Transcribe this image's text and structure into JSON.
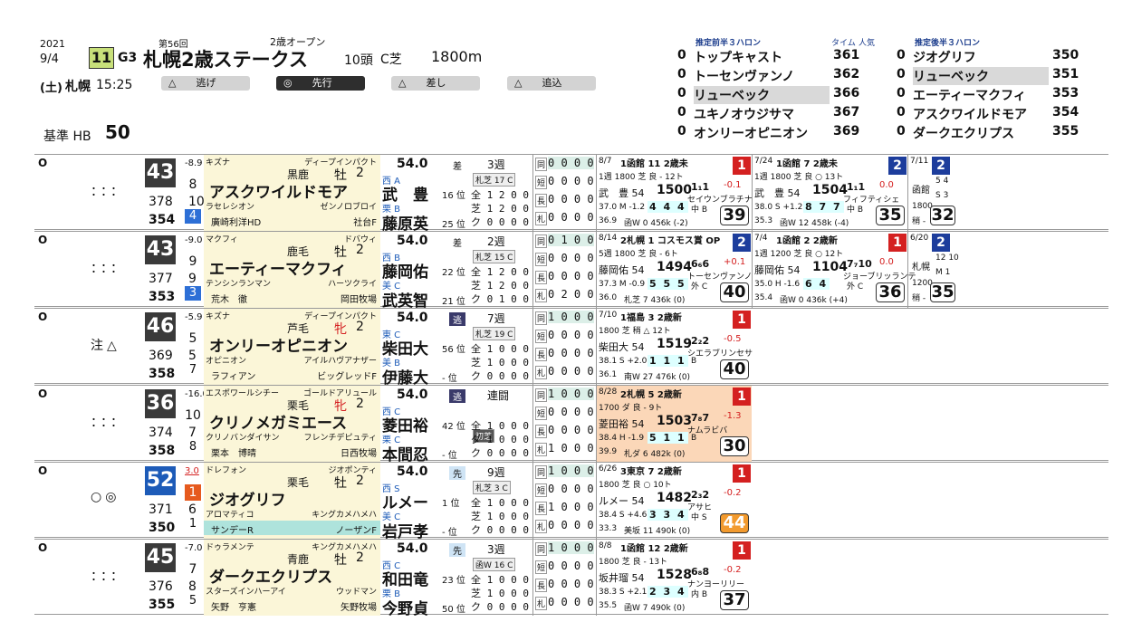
{
  "header": {
    "year": "2021",
    "date": "9/4",
    "day": "(土)",
    "venue": "札幌",
    "post_time": "15:25",
    "race_no": "11",
    "grade": "G3",
    "race_name": "札幌2歳ステークス",
    "edition": "第56回",
    "race_class": "2歳オープン",
    "field_size": "10頭",
    "course": "C芝",
    "distance": "1800m",
    "base_label": "基準 HB",
    "base_value": "50",
    "pace_styles": [
      {
        "mark": "△",
        "label": "逃げ"
      },
      {
        "mark": "◎",
        "label": "先行"
      },
      {
        "mark": "△",
        "label": "差し"
      },
      {
        "mark": "△",
        "label": "追込"
      }
    ]
  },
  "pace_top": {
    "title": "推定前半３ハロン",
    "col_time": "タイム",
    "col_pop": "人気",
    "rows": [
      {
        "pre": "0",
        "name": "トップキャスト",
        "time": "361"
      },
      {
        "pre": "0",
        "name": "トーセンヴァンノ",
        "time": "362"
      },
      {
        "pre": "0",
        "name": "リューベック",
        "time": "366"
      },
      {
        "pre": "0",
        "name": "ユキノオウジサマ",
        "time": "367"
      },
      {
        "pre": "0",
        "name": "オンリーオピニオン",
        "time": "369"
      }
    ]
  },
  "pace_late": {
    "title": "推定後半３ハロン",
    "rows": [
      {
        "pre": "0",
        "name": "ジオグリフ",
        "time": "350"
      },
      {
        "pre": "0",
        "name": "リューベック",
        "time": "351"
      },
      {
        "pre": "0",
        "name": "エーティーマクフィ",
        "time": "353"
      },
      {
        "pre": "0",
        "name": "アスクワイルドモア",
        "time": "354"
      },
      {
        "pre": "0",
        "name": "ダークエクリプス",
        "time": "355"
      }
    ]
  },
  "horses": [
    {
      "mark": "O",
      "marks": "：：：",
      "idx": "43",
      "idx_diff": "-8.9",
      "idx_sub": "8",
      "v1": "378",
      "v1b": "10",
      "v2": "354",
      "gate": "4",
      "gate_color": "#2d6fd6",
      "sire": "キズナ",
      "dam_sire": "ディープインパクト",
      "coat": "黒鹿",
      "sex": "牡",
      "age": "2",
      "name": "アスクワイルドモア",
      "dam": "ラセレシオン",
      "bms": "ゼンノロブロイ",
      "owner": "廣崎利洋HD",
      "breeder": "社台F",
      "owner_bg": "#fbf6d8",
      "weight": "54.0",
      "style": "差",
      "jockey_region": "西",
      "jockey_grade": "A",
      "jockey": "武　豊",
      "jockey_pos": "16 位",
      "trainer_region": "栗",
      "trainer_grade": "B",
      "trainer": "藤原英",
      "trainer_pos": "25 位",
      "weeks": "3週",
      "course_tag": "札芝 17 C",
      "stats_label": [
        "同",
        "短",
        "長",
        "札"
      ],
      "stats": [
        "0 0 0 0",
        "0 0 0 0",
        "0 0 0 0",
        "0 0 0 0"
      ],
      "jstats": [
        "全 1 2 0 0",
        "芝 1 2 0 0",
        "ク 0 0 0 0"
      ],
      "past": [
        {
          "date": "8/7",
          "race": "1函館 11 2歳未",
          "rank": "1",
          "rank_color": "red",
          "dist": "1週 1800 芝 良 - 12ト",
          "pop": "1",
          "diff": "-0.1",
          "jockey": "武　豊 54",
          "time": "1500",
          "pos": "1₁1",
          "rival": "セイウンブラチナ",
          "l3": "37.0 M -1.2",
          "corners": "4 4 4",
          "side": "中 B",
          "hw": "36.9",
          "weight": "函W 0 456k (-2)",
          "score": "39"
        },
        {
          "date": "7/24",
          "race": "1函館 7 2歳未",
          "rank": "2",
          "rank_color": "blue",
          "dist": "1週 1800 芝 良 ○ 13ト",
          "pop": "4",
          "diff": "0.0",
          "jockey": "武　豊 54",
          "time": "1504",
          "pos": "1₁1",
          "rival": "フィフティシェ",
          "l3": "38.0 S +1.2",
          "corners": "8 7 7",
          "side": "中 B",
          "hw": "35.3",
          "weight": "函W 12 458k (-4)",
          "score": "35"
        },
        {
          "date": "7/11",
          "race": "函館",
          "rank": "2",
          "rank_color": "blue",
          "dist": "1800",
          "pop": "",
          "diff": "",
          "jockey": "5 4",
          "time": "S 3",
          "pos": "",
          "rival": "",
          "l3": "",
          "corners": "",
          "side": "",
          "hw": "",
          "weight": "稍 -",
          "score": "32"
        }
      ]
    },
    {
      "mark": "O",
      "marks": "：：：",
      "idx": "43",
      "idx_diff": "-9.0",
      "idx_sub": "9",
      "v1": "377",
      "v1b": "9",
      "v2": "353",
      "gate": "3",
      "gate_color": "#2d6fd6",
      "sire": "マクフィ",
      "dam_sire": "ドバウィ",
      "coat": "鹿毛",
      "sex": "牡",
      "age": "2",
      "name": "エーティーマクフィ",
      "dam": "テンシンランマン",
      "bms": "ハーツクライ",
      "owner": "荒木　徹",
      "breeder": "岡田牧場",
      "owner_bg": "#fbf6d8",
      "weight": "54.0",
      "style": "差",
      "jockey_region": "西",
      "jockey_grade": "B",
      "jockey": "藤岡佑",
      "jockey_pos": "22 位",
      "trainer_region": "美",
      "trainer_grade": "C",
      "trainer": "武英智",
      "trainer_pos": "21 位",
      "weeks": "2週",
      "course_tag": "札芝 15 C",
      "stats_label": [
        "同",
        "短",
        "長",
        "札"
      ],
      "stats": [
        "0 1 0 0",
        "0 0 0 0",
        "0 0 0 0",
        "0 2 0 0"
      ],
      "jstats": [
        "全 1 2 0 0",
        "芝 1 2 0 0",
        "ク 0 1 0 0"
      ],
      "past": [
        {
          "date": "8/14",
          "race": "2札幌 1 コスモス賞 OP",
          "rank": "2",
          "rank_color": "blue",
          "dist": "5週 1800 芝 良 - 6ト",
          "pop": "3",
          "diff": "+0.1",
          "jockey": "藤岡佑 54",
          "time": "1494",
          "pos": "6₆6",
          "rival": "トーセンヴァンノ",
          "l3": "37.3 M -0.9",
          "corners": "5 5 5",
          "side": "外 C",
          "hw": "36.0",
          "weight": "札芝 7 436k (0)",
          "score": "40"
        },
        {
          "date": "7/4",
          "race": "1函館 2 2歳新",
          "rank": "1",
          "rank_color": "red",
          "dist": "1週 1200 芝 良 ○ 12ト",
          "pop": "1",
          "diff": "0.0",
          "jockey": "藤岡佑 54",
          "time": "1104",
          "pos": "7₇10",
          "rival": "ジョーブリッランテ",
          "l3": "35.0 H -1.6",
          "corners": "6 4",
          "side": "外 C",
          "hw": "35.4",
          "weight": "函W 0 436k (+4)",
          "score": "36"
        },
        {
          "date": "6/20",
          "race": "札幌",
          "rank": "2",
          "rank_color": "blue",
          "dist": "1200",
          "pop": "",
          "diff": "",
          "jockey": "12 10",
          "time": "M 1",
          "pos": "",
          "rival": "",
          "l3": "",
          "corners": "",
          "side": "",
          "hw": "",
          "weight": "稍 -",
          "score": "35"
        }
      ]
    },
    {
      "mark": "O",
      "marks": "注△",
      "idx": "46",
      "idx_diff": "-5.9",
      "idx_sub": "5",
      "v1": "369",
      "v1b": "5",
      "v2": "358",
      "gate": "7",
      "gate_color": "#ffffff",
      "sire": "キズナ",
      "dam_sire": "ディープインパクト",
      "coat": "芦毛",
      "sex": "牝",
      "age": "2",
      "name": "オンリーオピニオン",
      "dam": "オピニオン",
      "bms": "アイルハヴアナザー",
      "owner": "ラフィアン",
      "breeder": "ビッグレッドF",
      "owner_bg": "#fbf6d8",
      "weight": "54.0",
      "style": "逃",
      "jockey_region": "東",
      "jockey_grade": "C",
      "jockey": "柴田大",
      "jockey_pos": "56 位",
      "trainer_region": "美",
      "trainer_grade": "B",
      "trainer": "伊藤大",
      "trainer_pos": "- 位",
      "weeks": "7週",
      "course_tag": "札芝 19 C",
      "stats_label": [
        "同",
        "短",
        "長",
        "札"
      ],
      "stats": [
        "1 0 0 0",
        "0 0 0 0",
        "0 0 0 0",
        "0 0 0 0"
      ],
      "jstats": [
        "全 1 0 0 0",
        "芝 1 0 0 0",
        "ク 0 0 0 0"
      ],
      "past": [
        {
          "date": "7/10",
          "race": "1福島 3 2歳新",
          "rank": "1",
          "rank_color": "red",
          "dist": "1800 芝 稍 △ 12ト",
          "pop": "1",
          "diff": "-0.5",
          "jockey": "柴田大 54",
          "time": "1519",
          "pos": "2₂2",
          "rival": "シエラブリンセサ",
          "l3": "38.1 S +2.0",
          "corners": "1 1 1",
          "side": "B",
          "hw": "36.1",
          "weight": "南W 27 476k (0)",
          "score": "40"
        }
      ]
    },
    {
      "mark": "O",
      "marks": "：：：",
      "idx": "36",
      "idx_diff": "-16.0",
      "idx_sub": "10",
      "v1": "374",
      "v1b": "7",
      "v2": "358",
      "gate": "8",
      "gate_color": "#ffffff",
      "sire": "エスポワールシチー",
      "dam_sire": "ゴールドアリュール",
      "coat": "栗毛",
      "sex": "牝",
      "age": "2",
      "name": "クリノメガミエース",
      "dam": "クリノバンダイサン",
      "bms": "フレンチデピュティ",
      "owner": "栗本　博晴",
      "breeder": "日西牧場",
      "owner_bg": "#fbf6d8",
      "weight": "54.0",
      "style": "逃",
      "jockey_region": "西",
      "jockey_grade": "C",
      "jockey": "菱田裕",
      "jockey_pos": "42 位",
      "trainer_region": "栗",
      "trainer_grade": "C",
      "trainer": "本間忍",
      "trainer_pos": "- 位",
      "weeks": "連闘",
      "course_tag": "初芝",
      "stats_label": [
        "同",
        "短",
        "長",
        "札"
      ],
      "stats": [
        "1 0 0 0",
        "0 0 0 0",
        "0 0 0 0",
        "1 0 0 0"
      ],
      "jstats": [
        "全 1 0 0 0",
        "ダ 1 0 0 0",
        "ク 0 0 0 0"
      ],
      "past": [
        {
          "date": "8/28",
          "race": "2札幌 5 2歳新",
          "rank": "1",
          "rank_color": "red",
          "dist": "1700 ダ 良 - 9ト",
          "pop": "7",
          "diff": "-1.3",
          "jockey": "菱田裕 54",
          "time": "1503",
          "pos": "7₈7",
          "rival": "ナムラビバ",
          "l3": "38.4 H -1.9",
          "corners": "5 1 1",
          "side": "B",
          "hw": "39.9",
          "weight": "札ダ 6 482k (0)",
          "score": "30"
        }
      ]
    },
    {
      "mark": "O",
      "marks": "○◎",
      "idx": "52",
      "idx_diff": "3.0",
      "idx_sub": "1",
      "v1": "371",
      "v1b": "6",
      "v2": "350",
      "gate": "1",
      "gate_color": "#ffffff",
      "sire": "ドレフォン",
      "dam_sire": "ジオポンティ",
      "coat": "栗毛",
      "sex": "牡",
      "age": "2",
      "name": "ジオグリフ",
      "dam": "アロマティコ",
      "bms": "キングカメハメハ",
      "owner": "サンデーR",
      "breeder": "ノーザンF",
      "owner_bg": "#aee3dc",
      "weight": "54.0",
      "style": "先",
      "jockey_region": "西",
      "jockey_grade": "S",
      "jockey": "ルメー",
      "jockey_pos": "1 位",
      "trainer_region": "美",
      "trainer_grade": "C",
      "trainer": "岩戸孝",
      "trainer_pos": "- 位",
      "weeks": "9週",
      "course_tag": "札芝 3 C",
      "stats_label": [
        "同",
        "短",
        "長",
        "札"
      ],
      "stats": [
        "1 0 0 0",
        "0 0 0 0",
        "1 0 0 0",
        "0 0 0 0"
      ],
      "jstats": [
        "全 1 0 0 0",
        "芝 1 0 0 0",
        "ク 0 0 0 0"
      ],
      "past": [
        {
          "date": "6/26",
          "race": "3東京 7 2歳新",
          "rank": "1",
          "rank_color": "red",
          "dist": "1800 芝 良 ○ 10ト",
          "pop": "3",
          "diff": "-0.2",
          "jockey": "ルメー 54",
          "time": "1482",
          "pos": "2₃2",
          "rival": "アサヒ",
          "l3": "38.4 S +4.6",
          "corners": "3 3 4",
          "side": "中 S",
          "hw": "33.3",
          "weight": "美坂 11 490k (0)",
          "score": "44"
        }
      ]
    },
    {
      "mark": "O",
      "marks": "：：：",
      "idx": "45",
      "idx_diff": "-7.0",
      "idx_sub": "7",
      "v1": "376",
      "v1b": "8",
      "v2": "355",
      "gate": "5",
      "gate_color": "#ffffff",
      "sire": "ドゥラメンテ",
      "dam_sire": "キングカメハメハ",
      "coat": "青鹿",
      "sex": "牡",
      "age": "2",
      "name": "ダークエクリプス",
      "dam": "スターズインハーアイ",
      "bms": "ウッドマン",
      "owner": "矢野　亨憲",
      "breeder": "矢野牧場",
      "owner_bg": "#fbf6d8",
      "weight": "54.0",
      "style": "先",
      "jockey_region": "西",
      "jockey_grade": "C",
      "jockey": "和田竜",
      "jockey_pos": "23 位",
      "trainer_region": "栗",
      "trainer_grade": "B",
      "trainer": "今野貞",
      "trainer_pos": "50 位",
      "weeks": "3週",
      "course_tag": "函W 16 C",
      "stats_label": [
        "同",
        "短",
        "長",
        "札"
      ],
      "stats": [
        "1 0 0 0",
        "0 0 0 0",
        "0 0 0 0",
        "0 0 0 0"
      ],
      "jstats": [
        "全 1 0 0 0",
        "芝 1 0 0 0",
        "ク 0 0 0 0"
      ],
      "past": [
        {
          "date": "8/8",
          "race": "1函館 12 2歳新",
          "rank": "1",
          "rank_color": "red",
          "dist": "1800 芝 良 - 13ト",
          "pop": "5",
          "diff": "-0.2",
          "jockey": "坂井瑠 54",
          "time": "1528",
          "pos": "6₈8",
          "rival": "ナンヨーリリー",
          "l3": "38.3 S +2.1",
          "corners": "2 3 4",
          "side": "内 B",
          "hw": "35.5",
          "weight": "函W 7 490k (0)",
          "score": "37"
        }
      ]
    }
  ]
}
